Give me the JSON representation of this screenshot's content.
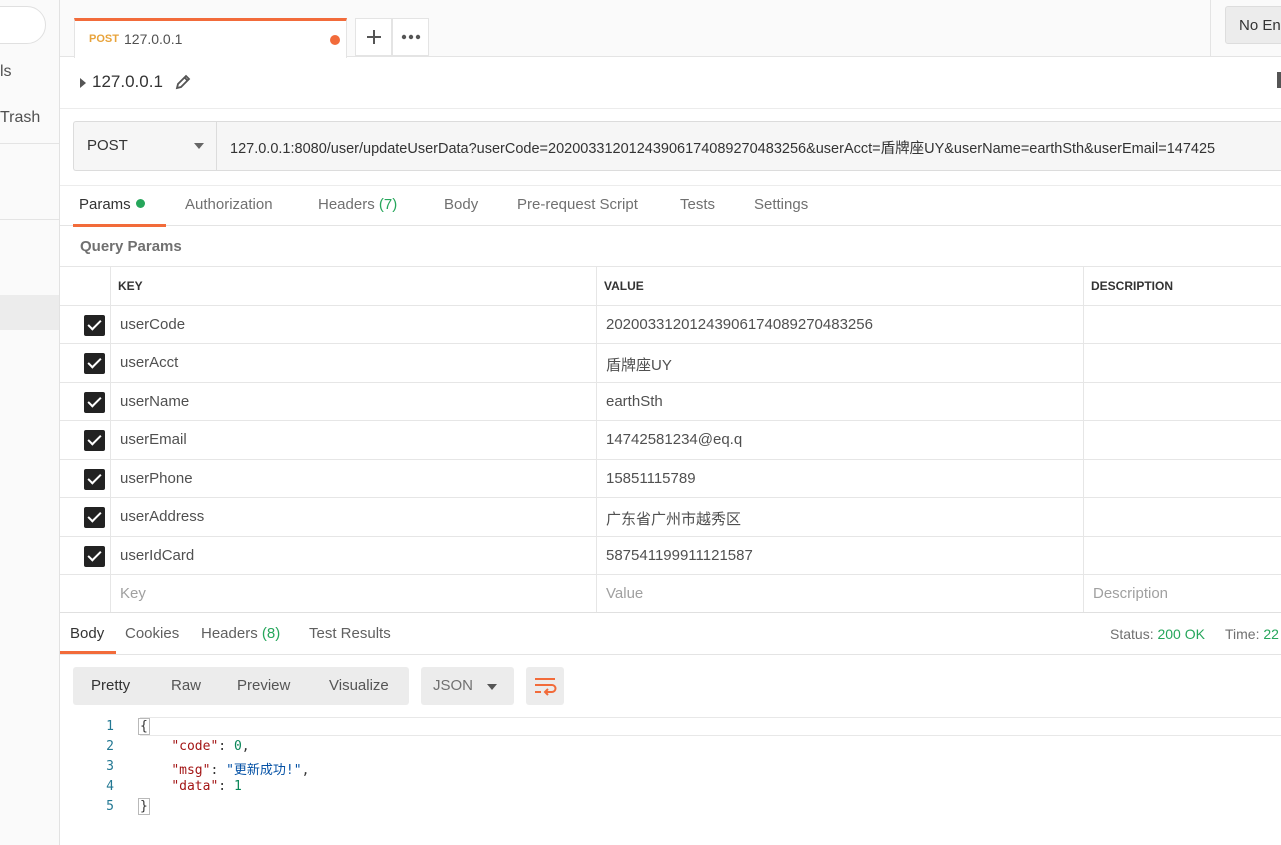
{
  "sidebar": {
    "item_partial_1": "ls",
    "item_partial_2": "Trash"
  },
  "tab": {
    "method": "POST",
    "name": "127.0.0.1"
  },
  "environment": {
    "label": "No En"
  },
  "request": {
    "title": "127.0.0.1",
    "method": "POST",
    "url": "127.0.0.1:8080/user/updateUserData?userCode=20200331201243906174089270483256&userAcct=盾牌座UY&userName=earthSth&userEmail=147425"
  },
  "request_tabs": [
    {
      "label": "Params"
    },
    {
      "label": "Authorization"
    },
    {
      "label": "Headers",
      "count": "(7)"
    },
    {
      "label": "Body"
    },
    {
      "label": "Pre-request Script"
    },
    {
      "label": "Tests"
    },
    {
      "label": "Settings"
    }
  ],
  "query_params": {
    "title": "Query Params",
    "headers": {
      "key": "KEY",
      "value": "VALUE",
      "description": "DESCRIPTION"
    },
    "rows": [
      {
        "key": "userCode",
        "value": "20200331201243906174089270483256",
        "checked": true
      },
      {
        "key": "userAcct",
        "value": "盾牌座UY",
        "checked": true
      },
      {
        "key": "userName",
        "value": "earthSth",
        "checked": true
      },
      {
        "key": "userEmail",
        "value": "14742581234@eq.q",
        "checked": true
      },
      {
        "key": "userPhone",
        "value": "15851115789",
        "checked": true
      },
      {
        "key": "userAddress",
        "value": "广东省广州市越秀区",
        "checked": true
      },
      {
        "key": "userIdCard",
        "value": "587541199911121587",
        "checked": true
      }
    ],
    "placeholders": {
      "key": "Key",
      "value": "Value",
      "description": "Description"
    }
  },
  "response_tabs": [
    {
      "label": "Body"
    },
    {
      "label": "Cookies"
    },
    {
      "label": "Headers",
      "count": "(8)"
    },
    {
      "label": "Test Results"
    }
  ],
  "response_status": {
    "status_label": "Status:",
    "status_value": "200 OK",
    "time_label": "Time:",
    "time_value": "22"
  },
  "view_modes": [
    "Pretty",
    "Raw",
    "Preview",
    "Visualize"
  ],
  "format": "JSON",
  "code_lines": [
    "1",
    "2",
    "3",
    "4",
    "5"
  ],
  "response_body": {
    "open": "{",
    "code_key": "\"code\"",
    "code_value": "0",
    "msg_key": "\"msg\"",
    "msg_value": "\"更新成功!\"",
    "data_key": "\"data\"",
    "data_value": "1",
    "close": "}"
  },
  "colors": {
    "accent": "#f26b3a",
    "success": "#26a65b",
    "method_post": "#e8a33b"
  }
}
